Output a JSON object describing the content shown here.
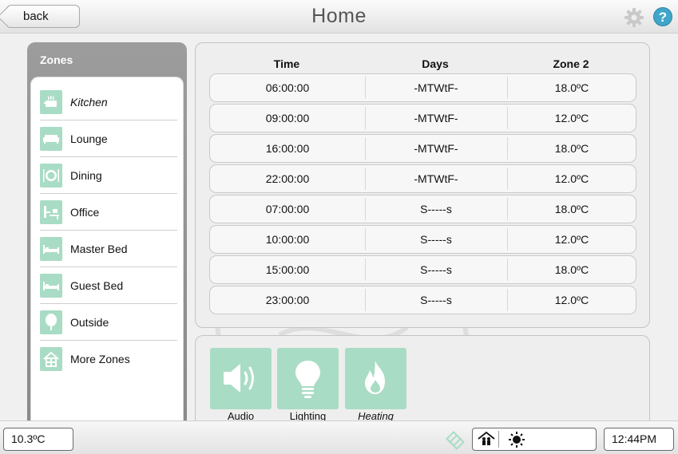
{
  "header": {
    "back_label": "back",
    "title": "Home"
  },
  "sidebar": {
    "title": "Zones",
    "items": [
      {
        "label": "Kitchen",
        "icon": "kitchen-icon",
        "active": true
      },
      {
        "label": "Lounge",
        "icon": "sofa-icon"
      },
      {
        "label": "Dining",
        "icon": "plate-icon"
      },
      {
        "label": "Office",
        "icon": "desk-icon"
      },
      {
        "label": "Master Bed",
        "icon": "bed-icon"
      },
      {
        "label": "Guest Bed",
        "icon": "bed-icon"
      },
      {
        "label": "Outside",
        "icon": "tree-icon"
      },
      {
        "label": "More Zones",
        "icon": "house-icon"
      }
    ]
  },
  "schedule": {
    "headers": {
      "time": "Time",
      "days": "Days",
      "zone": "Zone 2"
    },
    "rows": [
      {
        "time": "06:00:00",
        "days": "-MTWtF-",
        "temp": "18.0ºC"
      },
      {
        "time": "09:00:00",
        "days": "-MTWtF-",
        "temp": "12.0ºC"
      },
      {
        "time": "16:00:00",
        "days": "-MTWtF-",
        "temp": "18.0ºC"
      },
      {
        "time": "22:00:00",
        "days": "-MTWtF-",
        "temp": "12.0ºC"
      },
      {
        "time": "07:00:00",
        "days": "S-----s",
        "temp": "18.0ºC"
      },
      {
        "time": "10:00:00",
        "days": "S-----s",
        "temp": "12.0ºC"
      },
      {
        "time": "15:00:00",
        "days": "S-----s",
        "temp": "18.0ºC"
      },
      {
        "time": "23:00:00",
        "days": "S-----s",
        "temp": "12.0ºC"
      }
    ]
  },
  "services": {
    "tiles": [
      {
        "label": "Audio",
        "icon": "speaker-icon"
      },
      {
        "label": "Lighting",
        "icon": "bulb-icon"
      },
      {
        "label": "Heating",
        "icon": "flame-icon",
        "active": true
      }
    ]
  },
  "footer": {
    "temperature": "10.3ºC",
    "time": "12:44PM"
  },
  "colors": {
    "accent": "#a9dcc5",
    "sidebar": "#8f8f8f",
    "help": "#3fa6c9"
  }
}
